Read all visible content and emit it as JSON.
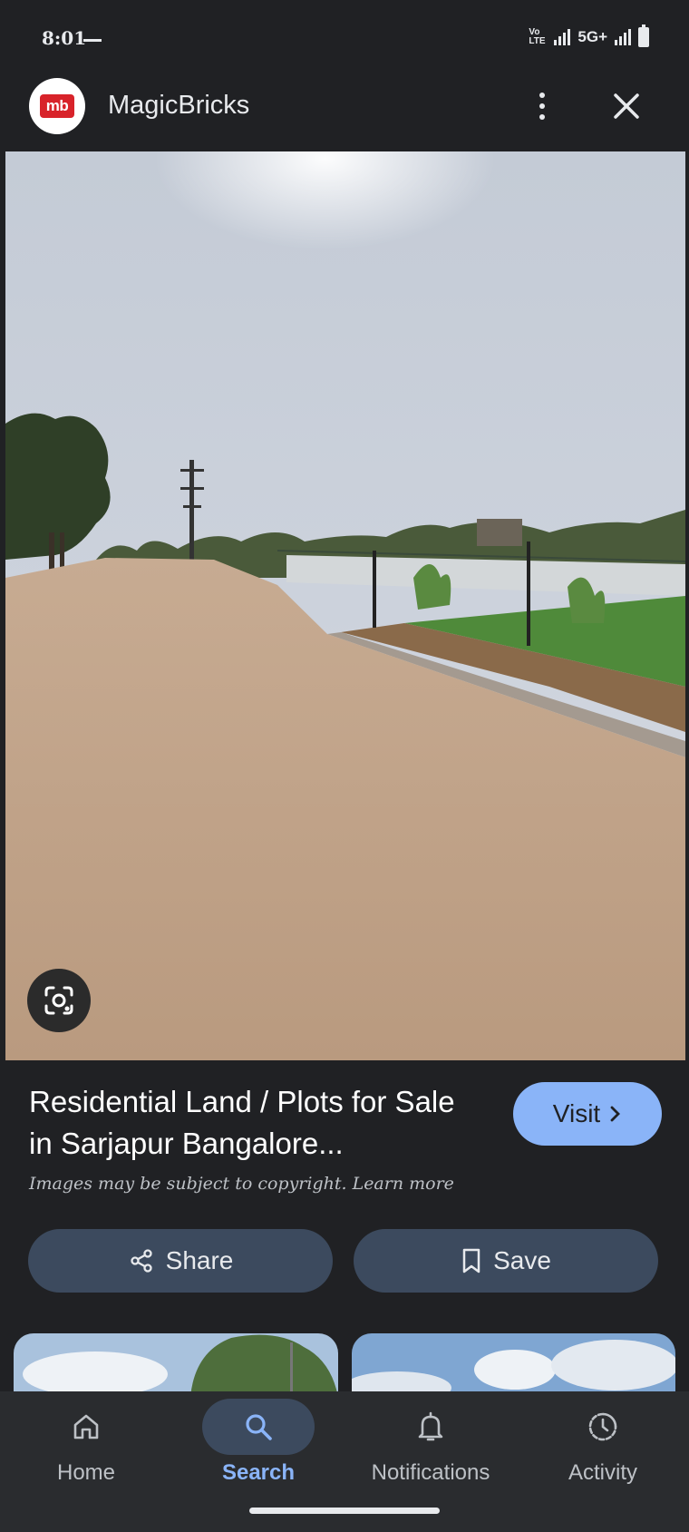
{
  "status_bar": {
    "time": "8:01",
    "network": "5G+",
    "volte": "Vo LTE"
  },
  "header": {
    "logo_text": "mb",
    "title": "MagicBricks",
    "icons": [
      "more-vert-icon",
      "close-icon"
    ]
  },
  "result": {
    "title": "Residential Land / Plots for Sale in Sarjapur Bangalore...",
    "visit_label": "Visit",
    "copyright": "Images may be subject to copyright. Learn more"
  },
  "actions": {
    "share_label": "Share",
    "save_label": "Save"
  },
  "bottom_nav": {
    "items": [
      {
        "label": "Home",
        "icon": "home-icon",
        "active": false
      },
      {
        "label": "Search",
        "icon": "search-icon",
        "active": true
      },
      {
        "label": "Notifications",
        "icon": "bell-icon",
        "active": false
      },
      {
        "label": "Activity",
        "icon": "activity-icon",
        "active": false
      }
    ]
  },
  "colors": {
    "background": "#202124",
    "accent": "#8ab4f8",
    "button_bg": "#3c4a5e",
    "brand_red": "#d8232a"
  }
}
